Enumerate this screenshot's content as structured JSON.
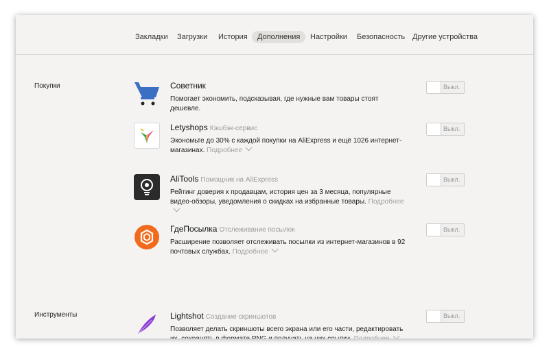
{
  "nav": {
    "tabs": [
      {
        "label": "Закладки"
      },
      {
        "label": "Загрузки"
      },
      {
        "label": "История"
      },
      {
        "label": "Дополнения"
      },
      {
        "label": "Настройки"
      },
      {
        "label": "Безопасность"
      },
      {
        "label": "Другие устройства"
      }
    ],
    "active_tab": "Дополнения"
  },
  "sections": [
    {
      "label": "Покупки"
    },
    {
      "label": "Инструменты"
    }
  ],
  "toggle_off_label": "Выкл.",
  "more_label": "Подробнее",
  "extensions": [
    {
      "title": "Советник",
      "subtitle": "",
      "description": "Помогает экономить, подсказывая, где нужные вам товары стоят дешевле.",
      "enabled": false
    },
    {
      "title": "Letyshops",
      "subtitle": "Кэшбэк-сервис",
      "description": "Экономьте до 30% с каждой покупки на AliExpress и ещё 1026 интернет-магазинах.",
      "enabled": false
    },
    {
      "title": "AliTools",
      "subtitle": "Помощник на AliExpress",
      "description": "Рейтинг доверия к продавцам, история цен за 3 месяца, популярные видео-обзоры, уведомления о скидках на избранные товары.",
      "enabled": false
    },
    {
      "title": "ГдеПосылка",
      "subtitle": "Отслеживание посылок",
      "description": "Расширение позволяет отслеживать посылки из интернет-магазинов в 92 почтовых службах.",
      "enabled": false
    },
    {
      "title": "Lightshot",
      "subtitle": "Создание скриншотов",
      "description": "Позволяет делать скриншоты всего экрана или его части, редактировать их, сохранять в формате PNG и получать на них ссылки.",
      "enabled": false
    }
  ],
  "colors": {
    "cart_blue": "#3a6fc4",
    "alitools_bg": "#2b2b2b",
    "gdeposylka_orange": "#f26b1d",
    "lightshot_purple": "#8a3fd1"
  }
}
